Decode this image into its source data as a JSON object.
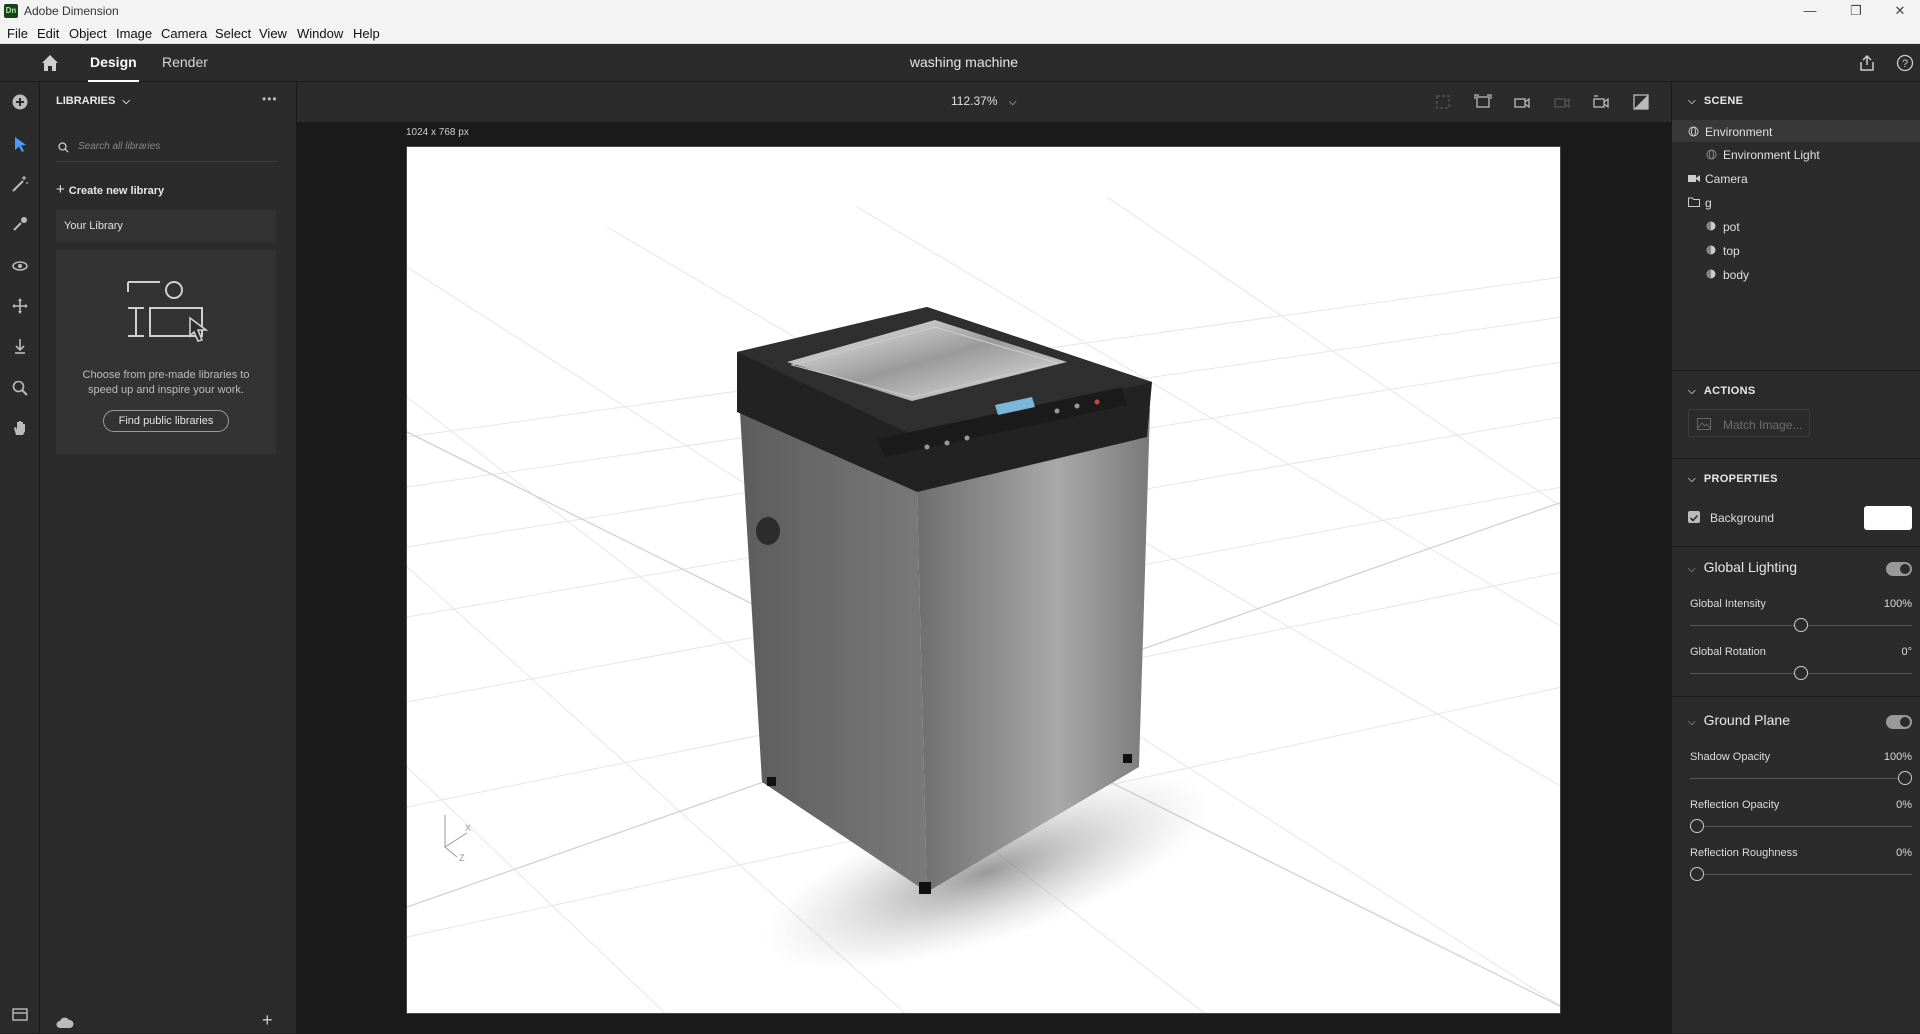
{
  "app": {
    "title": "Adobe Dimension",
    "logo": "Dn"
  },
  "window_controls": {
    "minimize": "—",
    "maximize": "❐",
    "close": "✕"
  },
  "menu": [
    "File",
    "Edit",
    "Object",
    "Image",
    "Camera",
    "Select",
    "View",
    "Window",
    "Help"
  ],
  "appbar": {
    "tabs": [
      "Design",
      "Render"
    ],
    "active_tab": "Design",
    "document_title": "washing machine"
  },
  "libraries": {
    "header": "LIBRARIES",
    "more": "•••",
    "search_placeholder": "Search all libraries",
    "create_new": "Create new library",
    "your_library": "Your Library",
    "empty_text_line1": "Choose from pre-made libraries to",
    "empty_text_line2": "speed up and inspire your work.",
    "find_public_button": "Find public libraries",
    "add": "+"
  },
  "canvas": {
    "zoom": "112.37%",
    "size_label": "1024 x 768 px",
    "axis_x": "X",
    "axis_z": "Z"
  },
  "scene": {
    "header": "SCENE",
    "items": {
      "environment": "Environment",
      "environment_light": "Environment Light",
      "camera": "Camera",
      "group": "g",
      "pot": "pot",
      "top": "top",
      "body": "body"
    }
  },
  "actions": {
    "header": "ACTIONS",
    "match_image": "Match Image..."
  },
  "properties": {
    "header": "PROPERTIES",
    "background_label": "Background",
    "background_color": "#ffffff",
    "global_lighting": {
      "title": "Global Lighting",
      "intensity_label": "Global Intensity",
      "intensity_value": "100%",
      "intensity_level": 0.5,
      "rotation_label": "Global Rotation",
      "rotation_value": "0°",
      "rotation_level": 0.5
    },
    "ground_plane": {
      "title": "Ground Plane",
      "shadow_label": "Shadow Opacity",
      "shadow_value": "100%",
      "shadow_level": 1.0,
      "reflection_label": "Reflection Opacity",
      "reflection_value": "0%",
      "reflection_level": 0,
      "roughness_label": "Reflection Roughness",
      "roughness_value": "0%",
      "roughness_level": 0
    }
  },
  "colors": {
    "panel": "#2b2b2b",
    "canvas_bg": "#1a1a1a",
    "accent": "#4a9df8"
  }
}
